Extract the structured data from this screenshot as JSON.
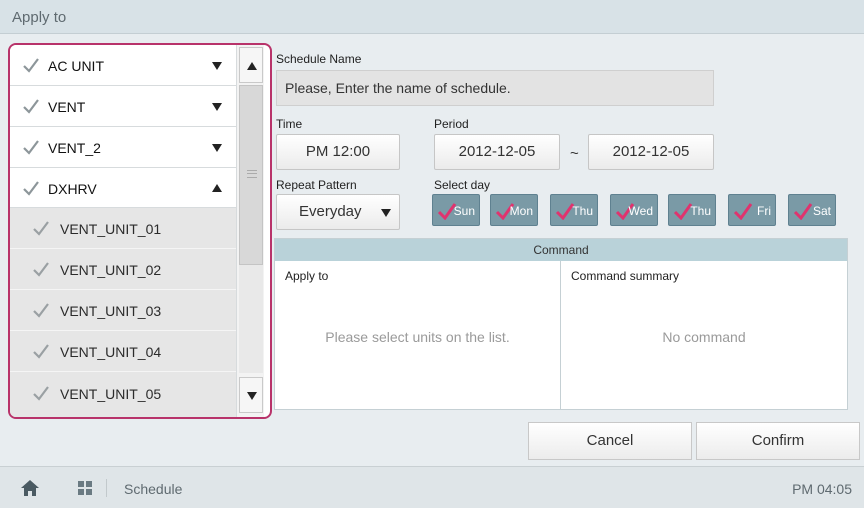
{
  "window": {
    "title": "Apply to"
  },
  "unit_list": {
    "groups": [
      {
        "label": "AC UNIT",
        "expanded": false
      },
      {
        "label": "VENT",
        "expanded": false
      },
      {
        "label": "VENT_2",
        "expanded": false
      },
      {
        "label": "DXHRV",
        "expanded": true
      }
    ],
    "sub_items": [
      {
        "label": "VENT_UNIT_01"
      },
      {
        "label": "VENT_UNIT_02"
      },
      {
        "label": "VENT_UNIT_03"
      },
      {
        "label": "VENT_UNIT_04"
      },
      {
        "label": "VENT_UNIT_05"
      }
    ]
  },
  "schedule": {
    "name_label": "Schedule Name",
    "name_placeholder": "Please, Enter the name of schedule.",
    "time_label": "Time",
    "time_value": "PM 12:00",
    "period_label": "Period",
    "period_start": "2012-12-05",
    "period_separator": "~",
    "period_end": "2012-12-05",
    "repeat_label": "Repeat Pattern",
    "repeat_value": "Everyday",
    "select_day_label": "Select day",
    "days": [
      "Sun",
      "Mon",
      "Thu",
      "Wed",
      "Thu",
      "Fri",
      "Sat"
    ]
  },
  "command": {
    "header": "Command",
    "apply_to_title": "Apply to",
    "apply_to_message": "Please select units on the list.",
    "summary_title": "Command summary",
    "summary_message": "No command"
  },
  "actions": {
    "cancel": "Cancel",
    "confirm": "Confirm"
  },
  "status_bar": {
    "screen": "Schedule",
    "clock": "PM 04:05"
  },
  "icons": [
    "check-icon",
    "caret-down-icon",
    "caret-up-icon",
    "scroll-up-icon",
    "scroll-down-icon",
    "home-icon",
    "grid-icon"
  ],
  "colors": {
    "highlight_border": "#b8336a",
    "check_pink": "#e0336e",
    "day_button": "#7a9aa6",
    "command_header": "#b9d2d9"
  }
}
